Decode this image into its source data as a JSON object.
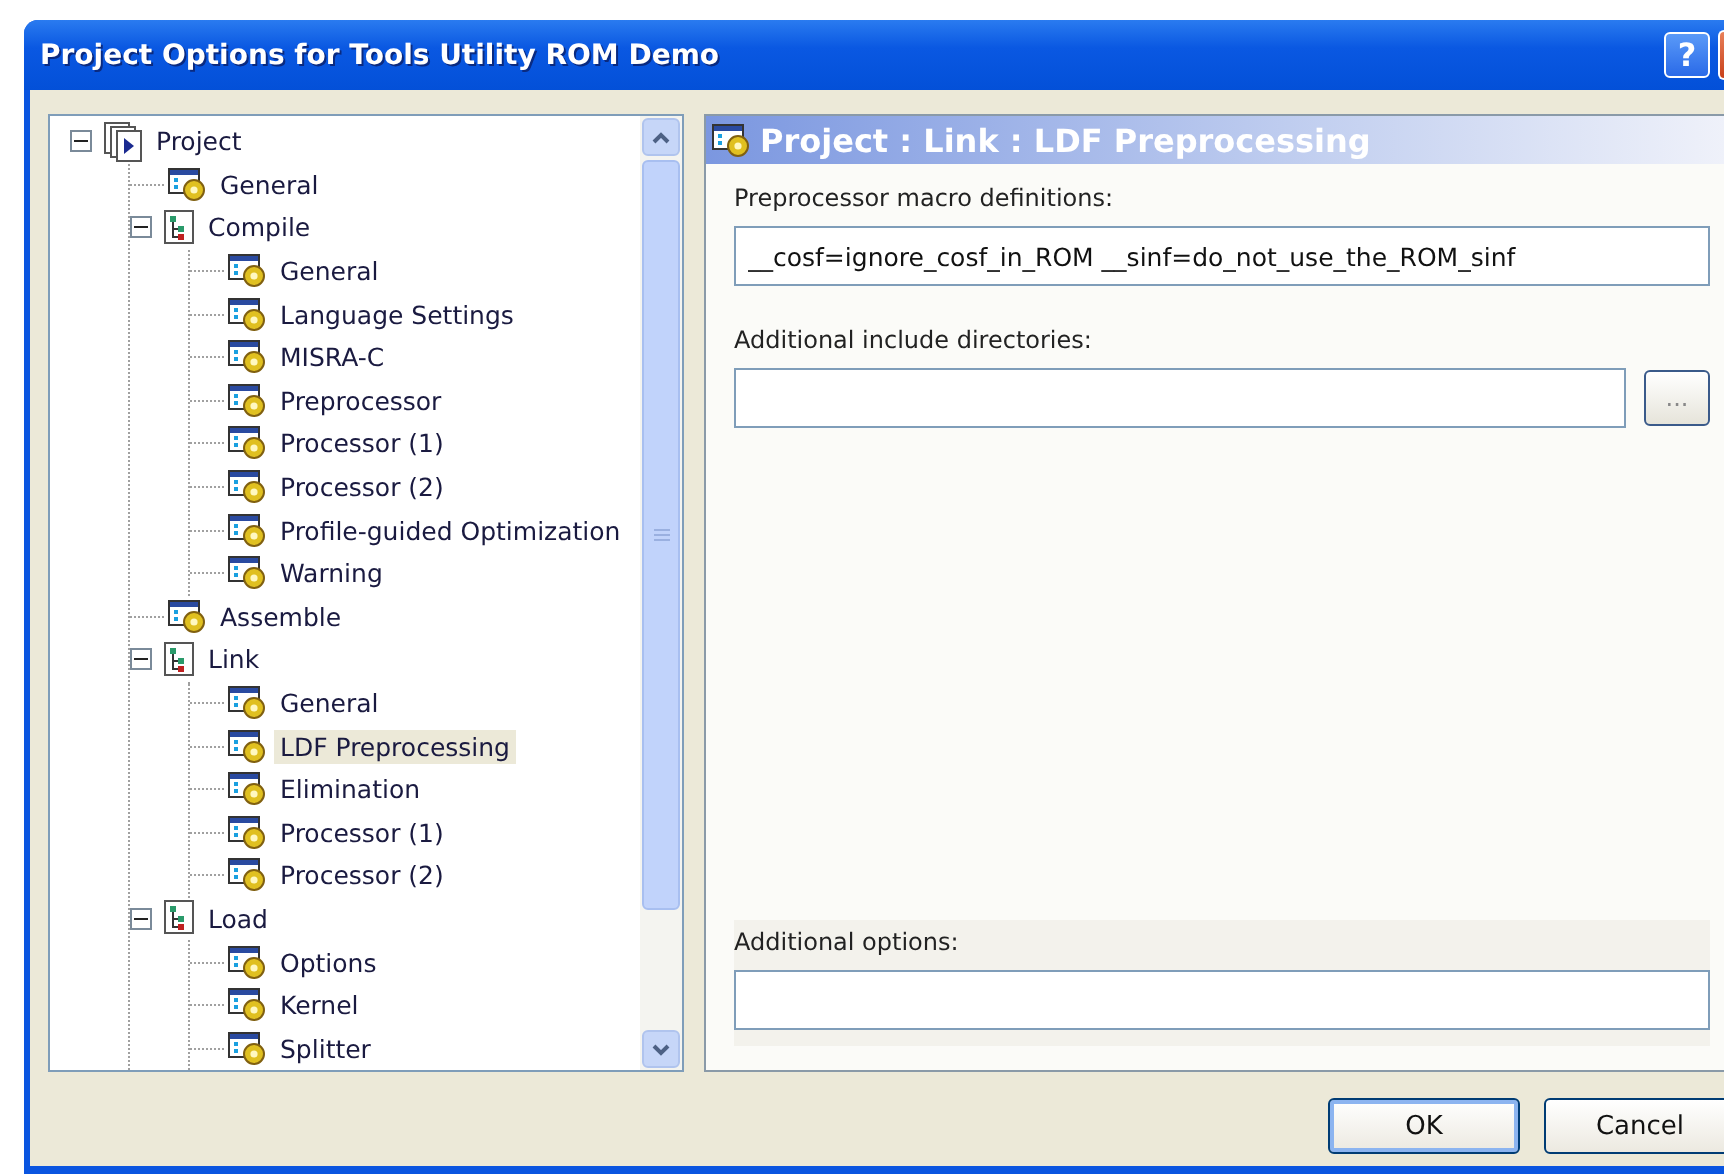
{
  "window": {
    "title": "Project Options for Tools Utility ROM Demo",
    "title_buttons": [
      "?"
    ]
  },
  "tree": [
    {
      "label": "Project",
      "kind": "project",
      "expanded": true,
      "selected": false,
      "children": [
        {
          "label": "General",
          "kind": "page",
          "selected": false
        },
        {
          "label": "Compile",
          "kind": "folder",
          "expanded": true,
          "selected": false,
          "children": [
            {
              "label": "General",
              "kind": "page",
              "selected": false
            },
            {
              "label": "Language Settings",
              "kind": "page",
              "selected": false
            },
            {
              "label": "MISRA-C",
              "kind": "page",
              "selected": false
            },
            {
              "label": "Preprocessor",
              "kind": "page",
              "selected": false
            },
            {
              "label": "Processor (1)",
              "kind": "page",
              "selected": false
            },
            {
              "label": "Processor (2)",
              "kind": "page",
              "selected": false
            },
            {
              "label": "Profile-guided Optimization",
              "kind": "page",
              "selected": false
            },
            {
              "label": "Warning",
              "kind": "page",
              "selected": false
            }
          ]
        },
        {
          "label": "Assemble",
          "kind": "page",
          "selected": false
        },
        {
          "label": "Link",
          "kind": "folder",
          "expanded": true,
          "selected": false,
          "children": [
            {
              "label": "General",
              "kind": "page",
              "selected": false
            },
            {
              "label": "LDF Preprocessing",
              "kind": "page",
              "selected": true
            },
            {
              "label": "Elimination",
              "kind": "page",
              "selected": false
            },
            {
              "label": "Processor (1)",
              "kind": "page",
              "selected": false
            },
            {
              "label": "Processor (2)",
              "kind": "page",
              "selected": false
            }
          ]
        },
        {
          "label": "Load",
          "kind": "folder",
          "expanded": true,
          "selected": false,
          "children": [
            {
              "label": "Options",
              "kind": "page",
              "selected": false
            },
            {
              "label": "Kernel",
              "kind": "page",
              "selected": false
            },
            {
              "label": "Splitter",
              "kind": "page",
              "selected": false
            }
          ]
        }
      ]
    }
  ],
  "page": {
    "heading": "Project : Link : LDF Preprocessing",
    "macro_label": "Preprocessor macro definitions:",
    "macro_value": "__cosf=ignore_cosf_in_ROM __sinf=do_not_use_the_ROM_sinf",
    "include_label": "Additional include directories:",
    "browse_button": "...",
    "options_label": "Additional options:"
  },
  "buttons": [
    "OK",
    "Cancel"
  ]
}
